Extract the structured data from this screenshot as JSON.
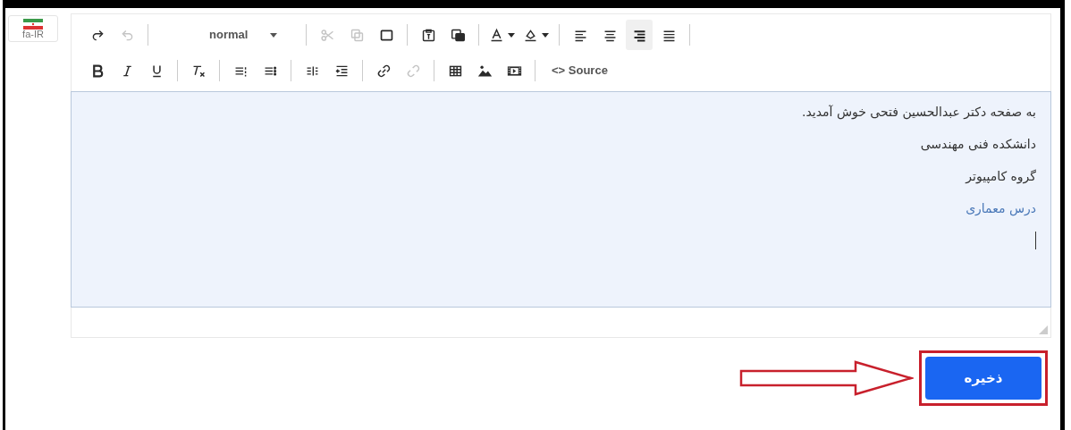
{
  "locale_button": {
    "label": "fa-IR"
  },
  "toolbar": {
    "rows": [
      {
        "groups": [
          [
            {
              "kind": "redo",
              "disabled": false,
              "selected": false
            },
            {
              "kind": "undo",
              "disabled": true,
              "selected": false
            }
          ],
          [
            {
              "kind": "format",
              "label": "normal",
              "disabled": false,
              "selected": false
            }
          ],
          [
            {
              "kind": "cut",
              "disabled": true,
              "selected": false
            },
            {
              "kind": "copy",
              "disabled": true,
              "selected": false
            },
            {
              "kind": "paste",
              "disabled": false,
              "selected": false
            }
          ],
          [
            {
              "kind": "pastetext",
              "disabled": false,
              "selected": false
            },
            {
              "kind": "pasteword",
              "disabled": false,
              "selected": false
            }
          ],
          [
            {
              "kind": "fontcolor",
              "disabled": false,
              "selected": false
            },
            {
              "kind": "bgcolor",
              "disabled": false,
              "selected": false
            }
          ],
          [
            {
              "kind": "alignleft",
              "disabled": false,
              "selected": false
            },
            {
              "kind": "aligncenter",
              "disabled": false,
              "selected": false
            },
            {
              "kind": "alignright",
              "disabled": false,
              "selected": true
            },
            {
              "kind": "justify",
              "disabled": false,
              "selected": false
            }
          ]
        ]
      },
      {
        "groups": [
          [
            {
              "kind": "bold",
              "disabled": false,
              "selected": false
            },
            {
              "kind": "italic",
              "disabled": false,
              "selected": false
            },
            {
              "kind": "underline",
              "disabled": false,
              "selected": false
            }
          ],
          [
            {
              "kind": "clearformat",
              "disabled": false,
              "selected": false
            }
          ],
          [
            {
              "kind": "orderedlist",
              "disabled": false,
              "selected": false
            },
            {
              "kind": "bulletlist",
              "disabled": false,
              "selected": false
            }
          ],
          [
            {
              "kind": "columns",
              "disabled": false,
              "selected": false
            },
            {
              "kind": "indent",
              "disabled": false,
              "selected": false
            }
          ],
          [
            {
              "kind": "link",
              "disabled": false,
              "selected": false
            },
            {
              "kind": "unlink",
              "disabled": true,
              "selected": false
            }
          ],
          [
            {
              "kind": "table",
              "disabled": false,
              "selected": false
            },
            {
              "kind": "image",
              "disabled": false,
              "selected": false
            },
            {
              "kind": "video",
              "disabled": false,
              "selected": false
            }
          ],
          [
            {
              "kind": "source",
              "symbol": "<>",
              "label": "Source",
              "disabled": false,
              "selected": false
            }
          ]
        ]
      }
    ]
  },
  "content": {
    "paragraphs": [
      {
        "kind": "text",
        "text": "به صفحه دکتر عبدالحسین فتحی خوش آمدید."
      },
      {
        "kind": "text",
        "text": "دانشکده فنی مهندسی"
      },
      {
        "kind": "text",
        "text": "گروه کامپیوتر"
      },
      {
        "kind": "link",
        "text": "درس معماری"
      }
    ]
  },
  "save_button": {
    "label": "ذخیره"
  }
}
